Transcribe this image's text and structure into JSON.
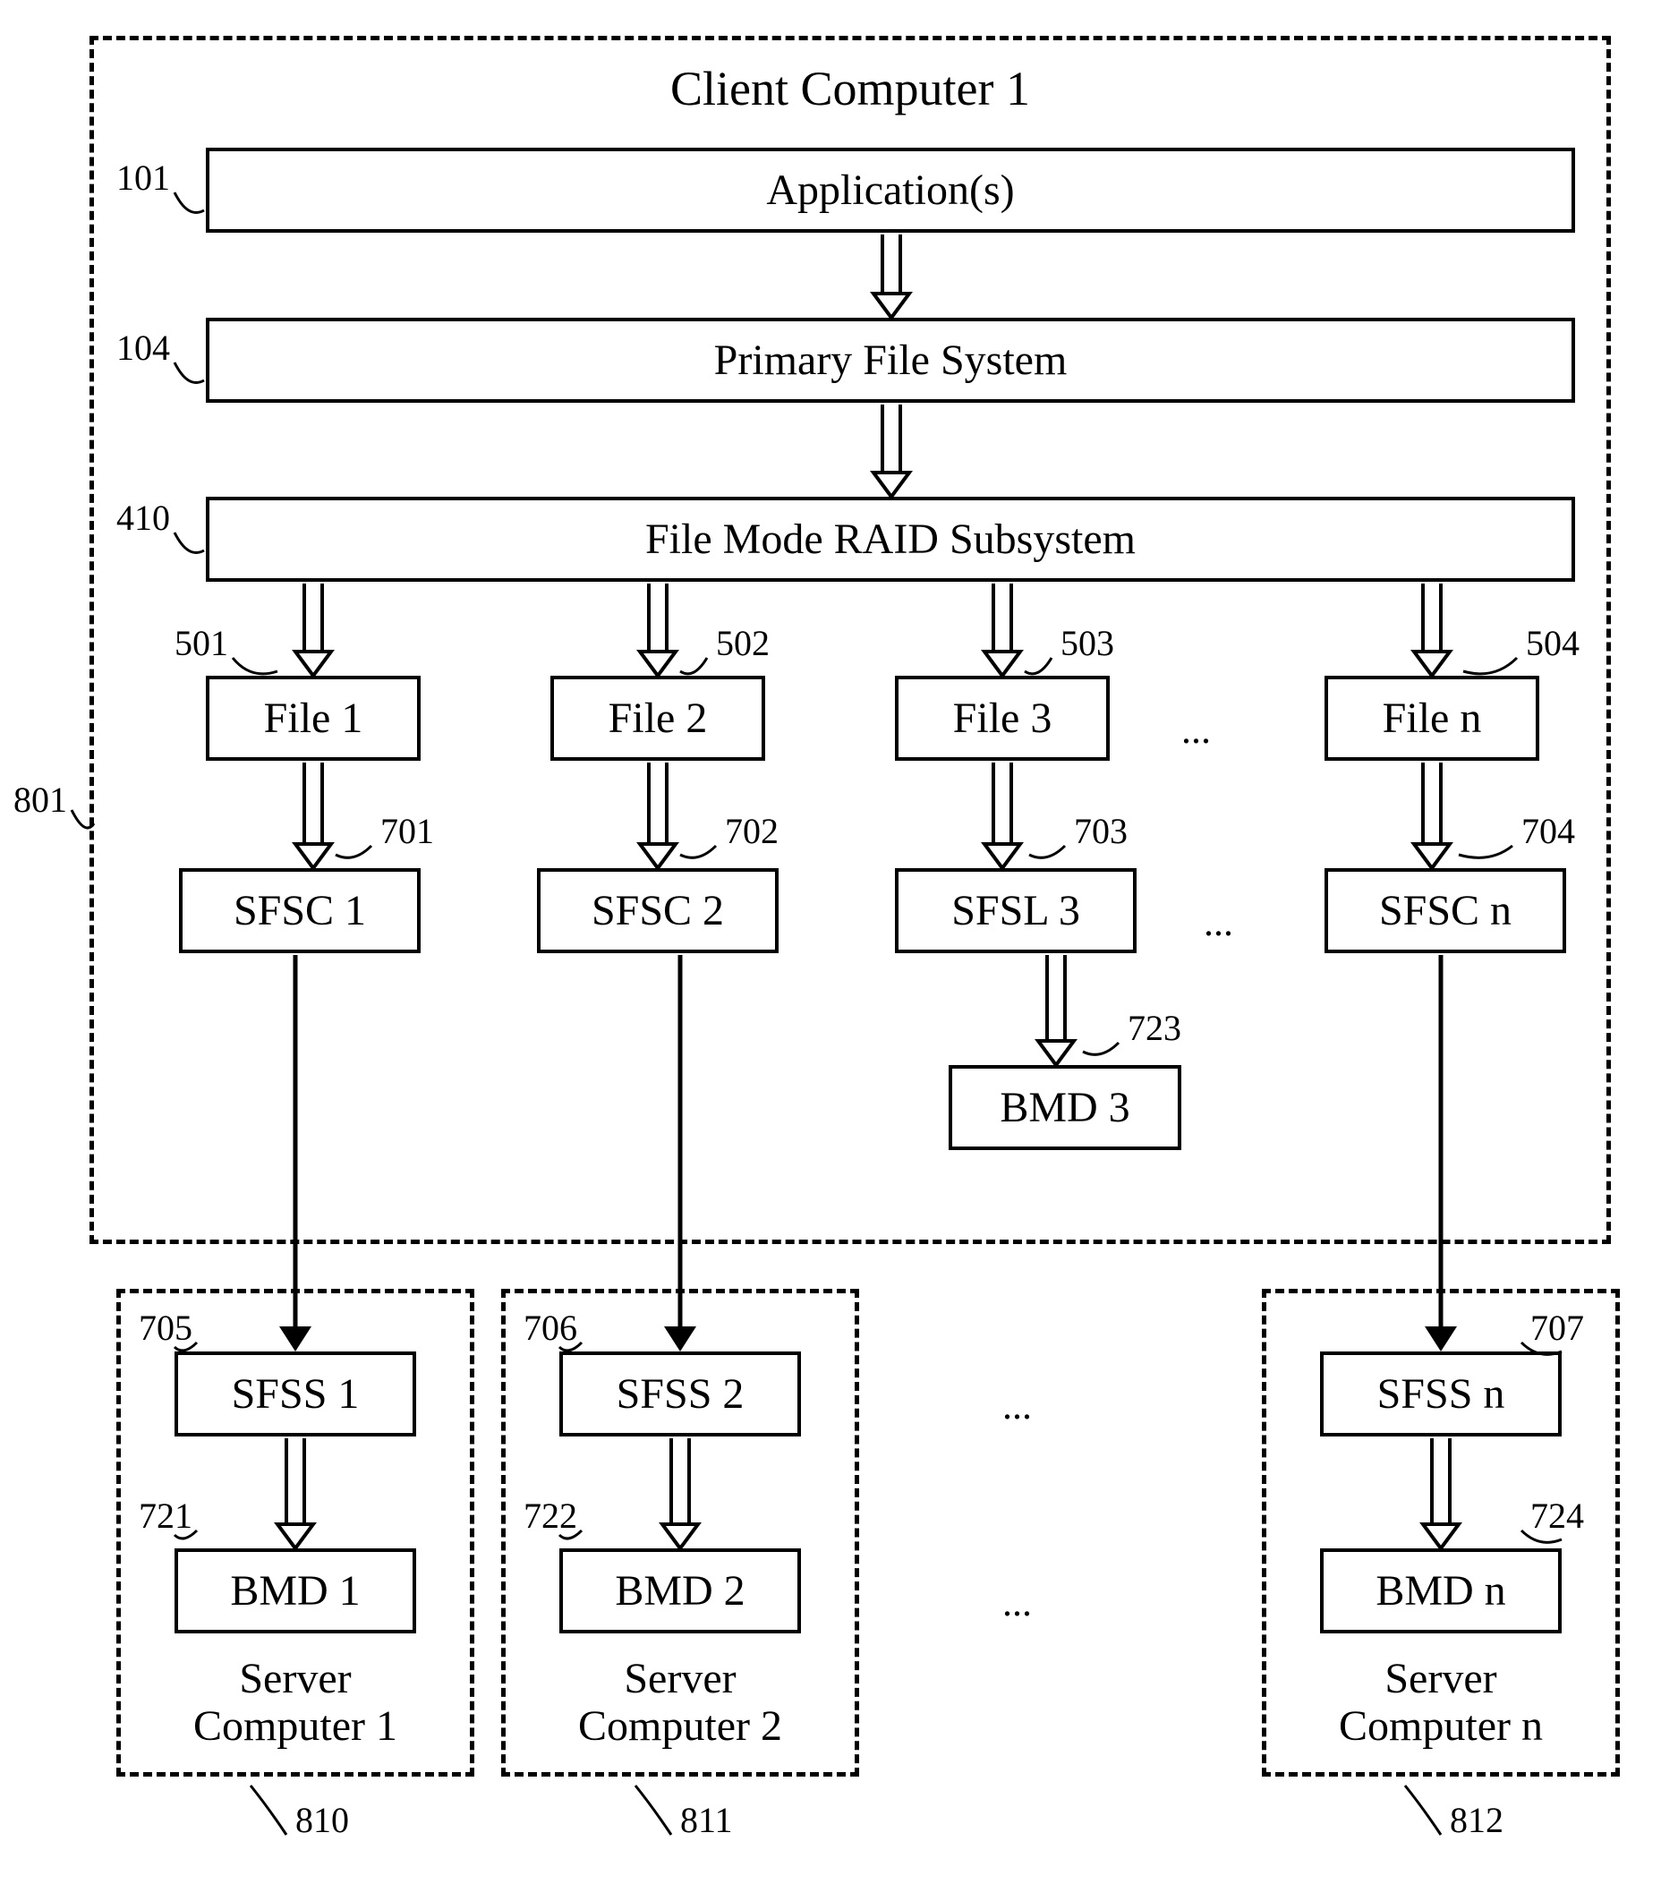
{
  "title": "Client Computer 1",
  "refs": {
    "r801": "801",
    "r101": "101",
    "r104": "104",
    "r410": "410",
    "r501": "501",
    "r502": "502",
    "r503": "503",
    "r504": "504",
    "r701": "701",
    "r702": "702",
    "r703": "703",
    "r704": "704",
    "r723": "723",
    "r705": "705",
    "r706": "706",
    "r707": "707",
    "r721": "721",
    "r722": "722",
    "r724": "724",
    "r810": "810",
    "r811": "811",
    "r812": "812"
  },
  "boxes": {
    "applications": "Application(s)",
    "primary_fs": "Primary File System",
    "raid": "File Mode RAID Subsystem",
    "file1": "File 1",
    "file2": "File 2",
    "file3": "File 3",
    "filen": "File n",
    "sfsc1": "SFSC 1",
    "sfsc2": "SFSC 2",
    "sfsl3": "SFSL 3",
    "sfscn": "SFSC n",
    "bmd3": "BMD 3",
    "sfss1": "SFSS 1",
    "sfss2": "SFSS 2",
    "sfssn": "SFSS n",
    "bmd1": "BMD 1",
    "bmd2": "BMD 2",
    "bmdn": "BMD n"
  },
  "server_labels": {
    "s1": "Server\nComputer 1",
    "s2": "Server\nComputer 2",
    "sn": "Server\nComputer n"
  },
  "ellipsis": "..."
}
